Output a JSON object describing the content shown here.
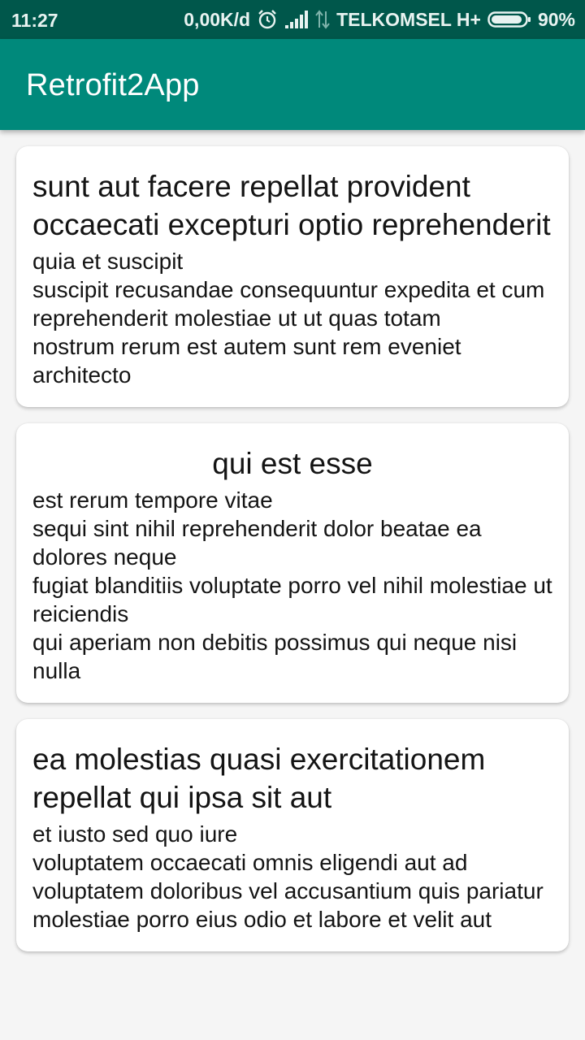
{
  "status_bar": {
    "time": "11:27",
    "network_speed": "0,00K/d",
    "carrier": "TELKOMSEL H+",
    "battery": "90%",
    "icons": [
      "alarm-icon",
      "signal-icon",
      "data-transfer-icon",
      "battery-icon"
    ]
  },
  "app_bar": {
    "title": "Retrofit2App",
    "color": "#00897b",
    "status_color": "#00574b"
  },
  "posts": [
    {
      "title": "sunt aut facere repellat provident occaecati excepturi optio reprehenderit",
      "body": "quia et suscipit\nsuscipit recusandae consequuntur expedita et cum\nreprehenderit molestiae ut ut quas totam\nnostrum rerum est autem sunt rem eveniet architecto"
    },
    {
      "title": "qui est esse",
      "body": "est rerum tempore vitae\nsequi sint nihil reprehenderit dolor beatae ea dolores neque\nfugiat blanditiis voluptate porro vel nihil molestiae ut reiciendis\nqui aperiam non debitis possimus qui neque nisi nulla"
    },
    {
      "title": "ea molestias quasi exercitationem repellat qui ipsa sit aut",
      "body": "et iusto sed quo iure\nvoluptatem occaecati omnis eligendi aut ad\nvoluptatem doloribus vel accusantium quis pariatur\nmolestiae porro eius odio et labore et velit aut"
    }
  ]
}
